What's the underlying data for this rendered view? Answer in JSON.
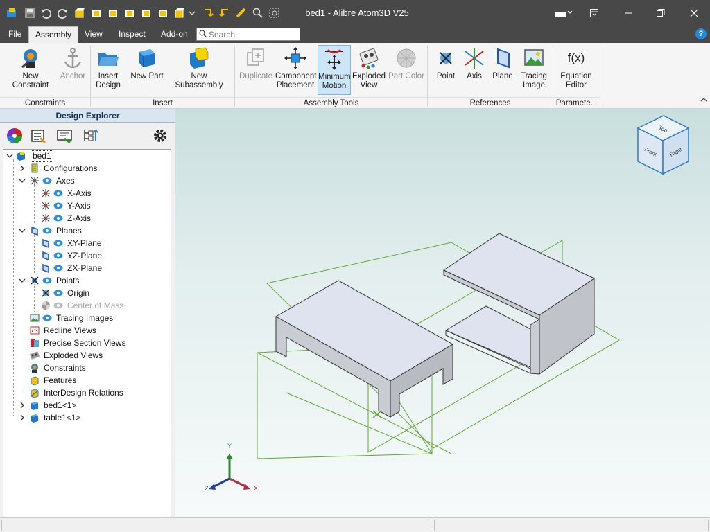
{
  "window": {
    "title": "bed1 - Alibre Atom3D V25"
  },
  "menu": {
    "tabs": [
      "File",
      "Assembly",
      "View",
      "Inspect",
      "Add-on"
    ],
    "active": "Assembly"
  },
  "search": {
    "placeholder": "Search"
  },
  "ribbon": {
    "buttons": {
      "new_constraint": "New Constraint",
      "anchor": "Anchor",
      "insert_design_1": "Insert",
      "insert_design_2": "Design",
      "new_part": "New Part",
      "new_subassembly": "New Subassembly",
      "duplicate": "Duplicate",
      "component_placement_1": "Component",
      "component_placement_2": "Placement",
      "minimum_motion_1": "Minimum",
      "minimum_motion_2": "Motion",
      "exploded_view_1": "Exploded",
      "exploded_view_2": "View",
      "part_color": "Part Color",
      "point": "Point",
      "axis": "Axis",
      "plane": "Plane",
      "tracing_image_1": "Tracing",
      "tracing_image_2": "Image",
      "equation_editor_1": "Equation",
      "equation_editor_2": "Editor",
      "fx_glyph": "f(x)"
    },
    "groups": {
      "constraints": "Constraints",
      "insert": "Insert",
      "assembly_tools": "Assembly Tools",
      "references": "References",
      "parameters": "Paramete..."
    }
  },
  "explorer": {
    "title": "Design Explorer",
    "tree": {
      "root": "bed1",
      "configurations": "Configurations",
      "axes": "Axes",
      "x_axis": "X-Axis",
      "y_axis": "Y-Axis",
      "z_axis": "Z-Axis",
      "planes": "Planes",
      "xy_plane": "XY-Plane",
      "yz_plane": "YZ-Plane",
      "zx_plane": "ZX-Plane",
      "points": "Points",
      "origin": "Origin",
      "center_of_mass": "Center of Mass",
      "tracing_images": "Tracing Images",
      "redline_views": "Redline Views",
      "precise_section_views": "Precise Section Views",
      "exploded_views": "Exploded Views",
      "constraints": "Constraints",
      "features": "Features",
      "interdesign_relations": "InterDesign Relations",
      "bed1_inst": "bed1<1>",
      "table1_inst": "table1<1>"
    }
  },
  "viewcube": {
    "top": "Top",
    "front": "Front",
    "right": "Right"
  },
  "triad": {
    "x": "X",
    "y": "Y",
    "z": "Z"
  },
  "colors": {
    "accent": "#1f8ae0",
    "titlebar": "#484848",
    "part_face": "#dfe3ef",
    "part_side": "#c5c9cf",
    "plane_green": "#5ea832"
  }
}
